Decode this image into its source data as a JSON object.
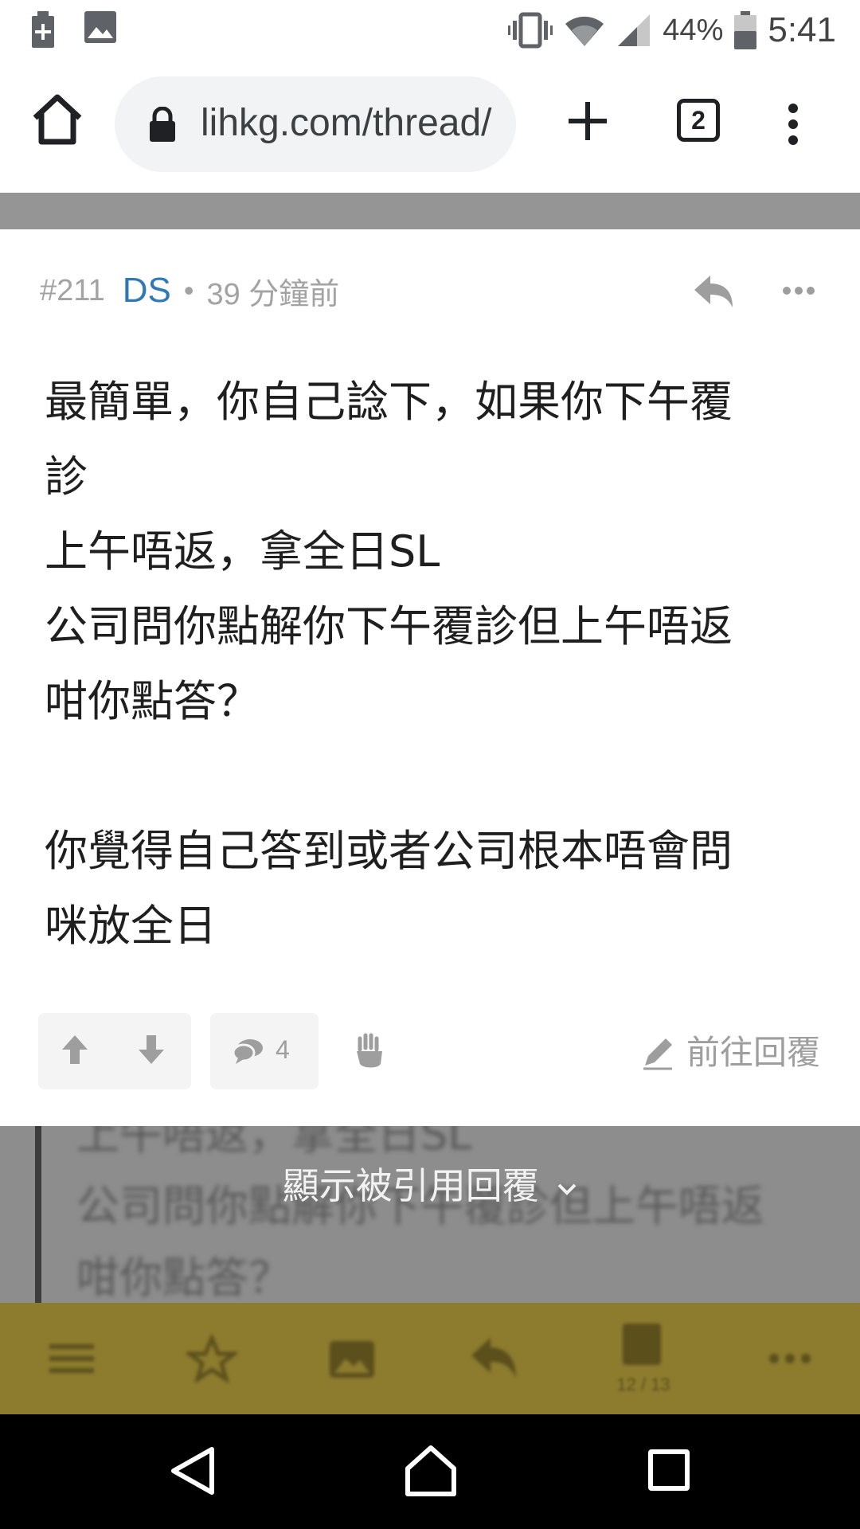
{
  "status_bar": {
    "battery_percent": "44%",
    "time": "5:41",
    "left_icons": [
      "battery-saver-icon",
      "image-icon"
    ],
    "right_icons": [
      "vibrate-icon",
      "wifi-icon",
      "signal-icon",
      "battery-icon"
    ]
  },
  "browser": {
    "url": "lihkg.com/thread/",
    "tab_count": "2",
    "icons": [
      "home-icon",
      "lock-icon",
      "plus-icon",
      "tab-switcher-icon",
      "more-vert-icon"
    ]
  },
  "post": {
    "number": "#211",
    "username": "DS",
    "separator": "•",
    "time_ago": "39 分鐘前",
    "body_lines": [
      "最簡單，你自己諗下，如果你下午覆",
      "診",
      "上午唔返，拿全日SL",
      "公司問你點解你下午覆診但上午唔返",
      "咁你點答？",
      "",
      "你覺得自己答到或者公司根本唔會問",
      "咪放全日"
    ],
    "comment_count": "4",
    "goto_reply_label": "前往回覆",
    "colors": {
      "username": "#2f7ab6",
      "meta": "#a3a3a3"
    }
  },
  "quoted": {
    "show_label": "顯示被引用回覆",
    "ghost_lines": [
      "上午唔返，拿全日SL",
      "公司問你點解你下午覆診但上午唔返",
      "咁你點答？"
    ]
  },
  "appbar": {
    "page_indicator": "12 / 13",
    "icons": [
      "menu-icon",
      "star-icon",
      "image-icon",
      "reply-icon",
      "page-icon",
      "more-horiz-icon"
    ],
    "color": "#8d7c2e"
  },
  "android_nav": {
    "icons": [
      "back-icon",
      "home-icon",
      "recents-icon"
    ]
  }
}
